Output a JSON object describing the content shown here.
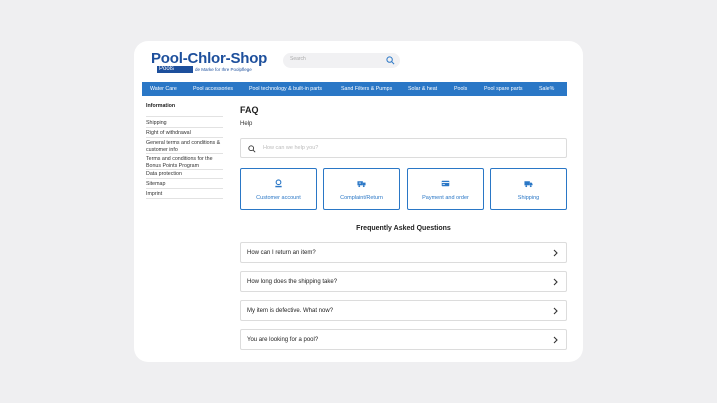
{
  "header": {
    "logo_text": "Pool-Chlor-Shop",
    "logo_sub": "Pools",
    "logo_tag": "de Marke for Ihre Poolpflege",
    "search_placeholder": "Search"
  },
  "nav": {
    "items": [
      {
        "label": "Water Care"
      },
      {
        "label": "Pool accessories"
      },
      {
        "label": "Pool technology & built-in parts"
      },
      {
        "label": "Sand Filters & Pumps"
      },
      {
        "label": "Solar & heat"
      },
      {
        "label": "Pools"
      },
      {
        "label": "Pool spare parts"
      },
      {
        "label": "Sale%"
      }
    ]
  },
  "sidebar": {
    "title": "Information",
    "items": [
      {
        "label": "Shipping"
      },
      {
        "label": "Right of withdrawal"
      },
      {
        "label": "General terms and conditions & customer info"
      },
      {
        "label": "Terms and conditions for the Bonus Points Program"
      },
      {
        "label": "Data protection"
      },
      {
        "label": "Sitemap"
      },
      {
        "label": "Imprint"
      }
    ]
  },
  "main": {
    "title": "FAQ",
    "subtitle": "Help",
    "search_placeholder": "How can we help you?",
    "categories": [
      {
        "label": "Customer account",
        "icon": "user-icon"
      },
      {
        "label": "Complaint/Return",
        "icon": "return-truck-icon"
      },
      {
        "label": "Payment and order",
        "icon": "payment-icon"
      },
      {
        "label": "Shipping",
        "icon": "truck-icon"
      }
    ],
    "faq_heading": "Frequently Asked Questions",
    "questions": [
      {
        "label": "How can I return an item?"
      },
      {
        "label": "How long does the shipping take?"
      },
      {
        "label": "My item is defective. What now?"
      },
      {
        "label": "You are looking for a pool?"
      }
    ]
  },
  "colors": {
    "accent": "#2a77c6",
    "brand": "#1d4f9c",
    "background": "#efeff1"
  }
}
